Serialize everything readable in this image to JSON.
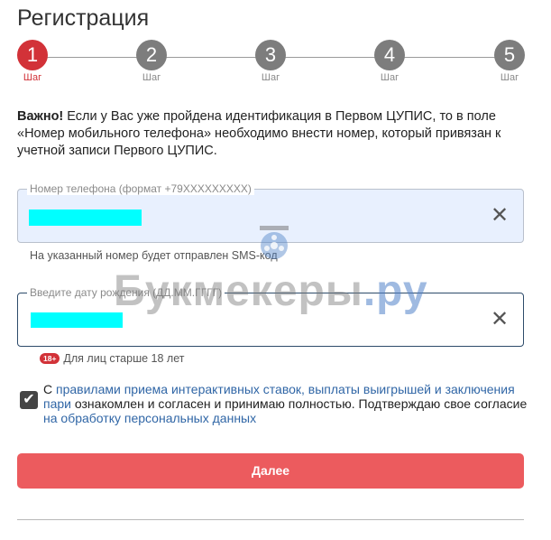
{
  "header": {
    "title": "Регистрация"
  },
  "steps": [
    {
      "number": "1",
      "label": "Шаг",
      "active": true
    },
    {
      "number": "2",
      "label": "Шаг",
      "active": false
    },
    {
      "number": "3",
      "label": "Шаг",
      "active": false
    },
    {
      "number": "4",
      "label": "Шаг",
      "active": false
    },
    {
      "number": "5",
      "label": "Шаг",
      "active": false
    }
  ],
  "warning": {
    "bold": "Важно!",
    "text": " Если у Вас уже пройдена идентификация в Первом ЦУПИС, то в поле «Номер мобильного телефона» необходимо внести номер, который привязан к учетной записи Первого ЦУПИС."
  },
  "phone_field": {
    "legend": "Номер телефона (формат +79XXXXXXXXX)",
    "hint": "На указанный номер будет отправлен SMS-код",
    "clear_icon": "✕"
  },
  "dob_field": {
    "legend": "Введите дату рождения (ДД.ММ.ГГГГ)",
    "clear_icon": "✕"
  },
  "age_notice": {
    "badge": "18+",
    "text": "Для лиц старше 18 лет"
  },
  "consent": {
    "checked": true,
    "prefix": "С ",
    "link1": "правилами приема интерактивных ставок, выплаты выигрышей и заключения пари",
    "middle": " ознакомлен и согласен и принимаю полностью. Подтверждаю свое согласие ",
    "link2": "на обработку персональных данных"
  },
  "next_button": {
    "label": "Далее"
  },
  "watermark": {
    "text": "Букмекеры",
    "suffix": ".ру"
  },
  "colors": {
    "accent_red": "#d23238",
    "button_red": "#ec5b5e",
    "link_blue": "#3066a6",
    "field_active_border": "#2d4b6a"
  }
}
